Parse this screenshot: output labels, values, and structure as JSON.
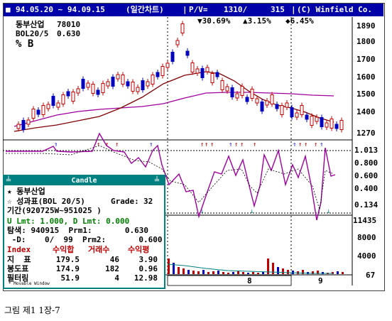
{
  "window": {
    "date_range": "94.05.20 ~ 94.09.15",
    "chart_kind": "(일간차트)",
    "pv_label": "P/V=",
    "pv_price": "1310/",
    "pv_volume": "315",
    "copyright": "(C) Winfield Co."
  },
  "chart_header": {
    "stock_name": "동부산업",
    "stock_code": "78010",
    "indicator": "BOL20/5",
    "indicator_value": "0.630",
    "mode": "% B",
    "stat1": "▼30.69%",
    "stat2": "▲3.15%",
    "stat3": "◆6.45%"
  },
  "price_axis": [
    "1890",
    "1800",
    "1700",
    "1600",
    "1500",
    "1400",
    "1270"
  ],
  "indicator_axis": [
    "1.013",
    "0.800",
    "0.600",
    "0.400",
    "0.134"
  ],
  "volume_axis": [
    "11435",
    "8000",
    "4000",
    "67"
  ],
  "x_axis": [
    "8",
    "9"
  ],
  "candle_panel": {
    "title": "Candle",
    "stock_line": "★ 동부산업",
    "result_line": "☆ 성과표(BOL 20/5)",
    "grade_label": "Grade:",
    "grade_value": "32",
    "period_line": "기간(920725W~951025 )",
    "limits_line": "U Lmt: 1.000, D Lmt: 0.000",
    "search_line": "탐색: 940915  Prm1:       0.630",
    "d_line": " -D:    0/  99  Prm2:       0.600",
    "headers": [
      "Index",
      "수익합",
      "거래수",
      "수익평"
    ],
    "rows": [
      {
        "name": "지  표",
        "sum": "179.5",
        "trades": "46",
        "avg": "3.90"
      },
      {
        "name": "봉도표",
        "sum": "174.9",
        "trades": "182",
        "avg": "0.96"
      },
      {
        "name": "필터링",
        "sum": "51.9",
        "trades": "4",
        "avg": "12.98"
      }
    ],
    "footer": "* Movable Window"
  },
  "caption": "그림 제1 1장-7",
  "colors": {
    "title_bg": "#0000a8",
    "candle_up": "#c00000",
    "candle_down": "#0000c0",
    "ma_long": "#a000a0",
    "ma_short": "#800000",
    "panel_border": "#008080"
  }
}
